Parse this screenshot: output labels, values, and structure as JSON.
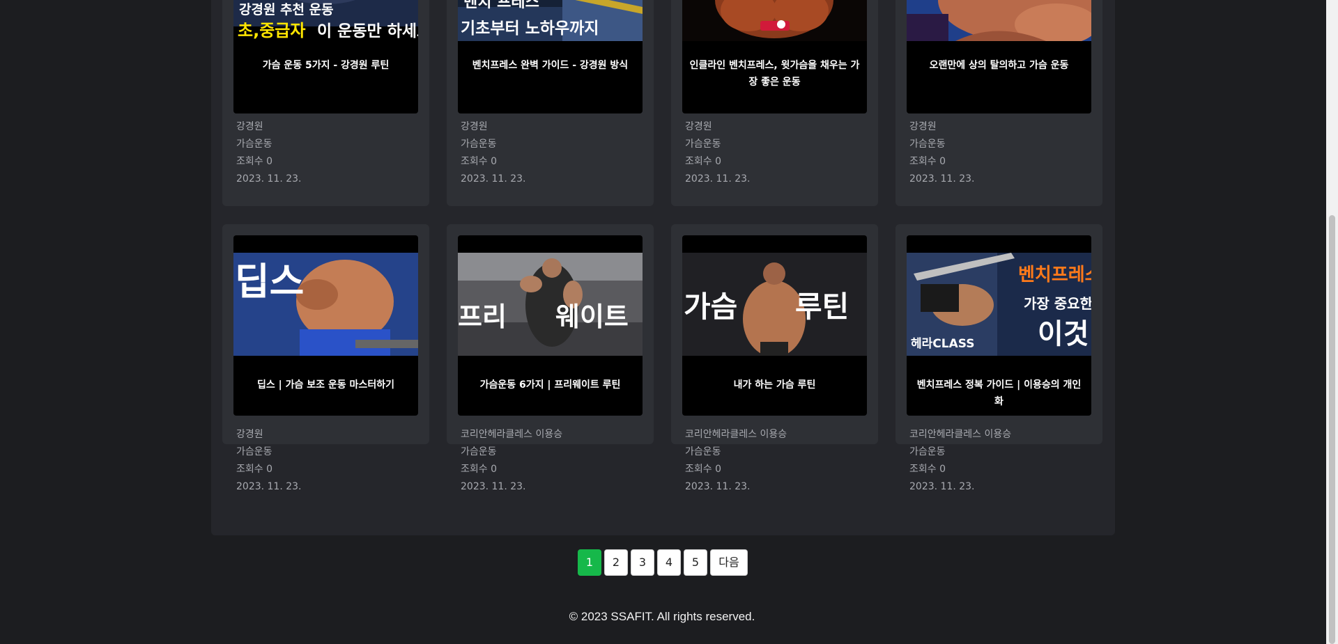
{
  "videos": [
    {
      "title": "가슴 운동 5가지 - 강경원 루틴",
      "channel": "강경원",
      "category": "가슴운동",
      "views": "조회수 0",
      "date": "2023. 11. 23.",
      "thumb_text": "강경원 추천 운동 초,중급자 이 운동만 하세요"
    },
    {
      "title": "벤치프레스 완벽 가이드 - 강경원 방식",
      "channel": "강경원",
      "category": "가슴운동",
      "views": "조회수 0",
      "date": "2023. 11. 23.",
      "thumb_text": "벤치 프레스 기초부터 노하우까지"
    },
    {
      "title": "인클라인 벤치프레스, 윗가슴을 채우는 가장 좋은 운동",
      "channel": "강경원",
      "category": "가슴운동",
      "views": "조회수 0",
      "date": "2023. 11. 23."
    },
    {
      "title": "오랜만에 상의 탈의하고 가슴 운동",
      "channel": "강경원",
      "category": "가슴운동",
      "views": "조회수 0",
      "date": "2023. 11. 23."
    },
    {
      "title": "딥스 | 가슴 보조 운동 마스터하기",
      "channel": "강경원",
      "category": "가슴운동",
      "views": "조회수 0",
      "date": "2023. 11. 23.",
      "thumb_text": "딥스"
    },
    {
      "title": "가슴운동 6가지 | 프리웨이트 루틴",
      "channel": "코리안헤라클레스 이용승",
      "category": "가슴운동",
      "views": "조회수 0",
      "date": "2023. 11. 23.",
      "thumb_text": "프리 웨이트"
    },
    {
      "title": "내가 하는 가슴 루틴",
      "channel": "코리안헤라클레스 이용승",
      "category": "가슴운동",
      "views": "조회수 0",
      "date": "2023. 11. 23.",
      "thumb_text": "가슴 루틴"
    },
    {
      "title": "벤치프레스 정복 가이드 | 이용승의 개인화",
      "channel": "코리안헤라클레스 이용승",
      "category": "가슴운동",
      "views": "조회수 0",
      "date": "2023. 11. 23.",
      "thumb_text": "벤치프레스 가장 중요한 이것 헤라CLASS"
    }
  ],
  "pagination": {
    "pages": [
      "1",
      "2",
      "3",
      "4",
      "5"
    ],
    "active": "1",
    "next_label": "다음"
  },
  "footer": {
    "text": "© 2023 SSAFIT. All rights reserved."
  }
}
